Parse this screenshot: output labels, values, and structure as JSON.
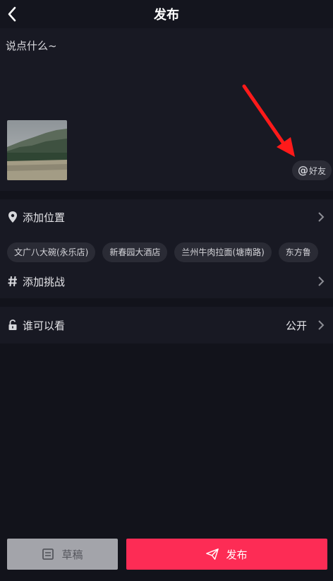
{
  "header": {
    "title": "发布"
  },
  "compose": {
    "caption_placeholder": "说点什么~",
    "at_friends_label": "好友",
    "at_symbol": "@"
  },
  "location": {
    "label": "添加位置",
    "suggestions": [
      "文广八大碗(永乐店)",
      "新春园大酒店",
      "兰州牛肉拉面(塘南路)",
      "东方鲁"
    ]
  },
  "challenge": {
    "label": "添加挑战"
  },
  "visibility": {
    "label": "谁可以看",
    "value": "公开"
  },
  "actions": {
    "draft_label": "草稿",
    "post_label": "发布"
  },
  "colors": {
    "accent": "#fd2c55",
    "background": "#12131b",
    "panel": "#181923",
    "annotation_arrow": "#ff1a1a"
  }
}
